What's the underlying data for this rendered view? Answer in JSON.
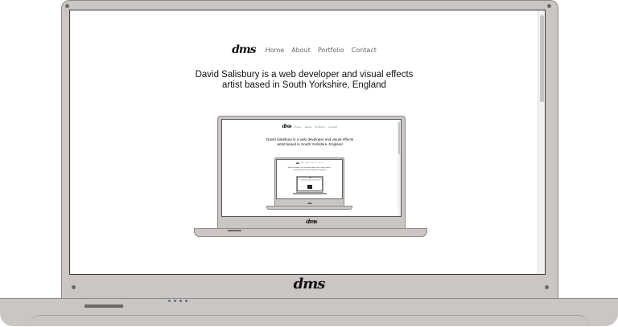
{
  "site": {
    "logo_text": "dms",
    "nav": [
      "Home",
      "About",
      "Portfolio",
      "Contact"
    ],
    "headline_line1": "David Salisbury is a web developer and visual effects",
    "headline_line2": "artist based in South Yorkshire, England"
  },
  "laptop": {
    "bottom_logo": "dms",
    "body_color": "#cbc5c4",
    "led_color": "#5b6f8a"
  }
}
